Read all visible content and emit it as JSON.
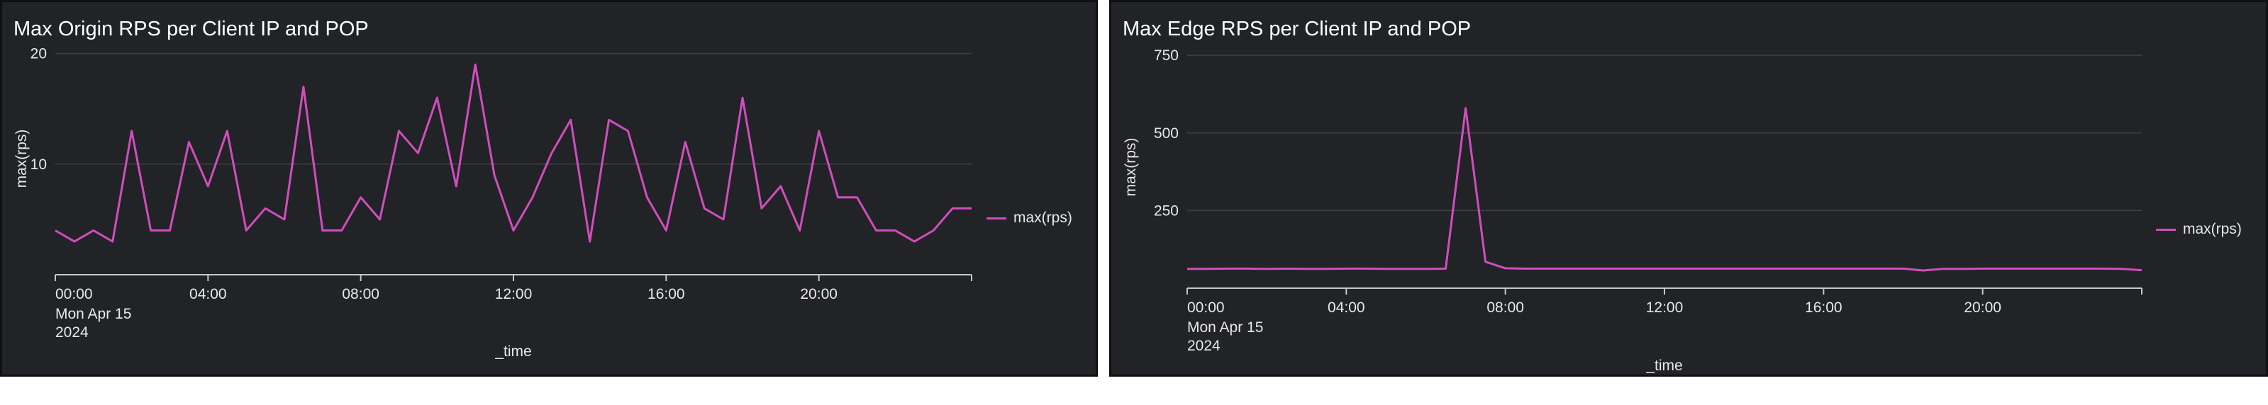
{
  "colors": {
    "panel_bg": "#212327",
    "series": "#d14dbd",
    "grid": "#3d4046",
    "axis": "#c8c8c8",
    "text": "#e8e8e8"
  },
  "panels": [
    {
      "title": "Max Origin RPS per Client IP and POP",
      "legend_label": "max(rps)"
    },
    {
      "title": "Max Edge RPS per Client IP and POP",
      "legend_label": "max(rps)"
    }
  ],
  "chart_data": [
    {
      "type": "line",
      "title": "Max Origin RPS per Client IP and POP",
      "xlabel": "_time",
      "ylabel": "max(rps)",
      "x_tick_labels": [
        "00:00",
        "04:00",
        "08:00",
        "12:00",
        "16:00",
        "20:00"
      ],
      "x_first_tick_sublabels": [
        "Mon Apr 15",
        "2024"
      ],
      "y_ticks": [
        10,
        20
      ],
      "ylim": [
        0,
        21
      ],
      "xlim_hours": [
        0,
        24
      ],
      "grid": true,
      "legend_position": "right",
      "series": [
        {
          "name": "max(rps)",
          "x_hours": [
            0,
            0.5,
            1,
            1.5,
            2,
            2.5,
            3,
            3.5,
            4,
            4.5,
            5,
            5.5,
            6,
            6.5,
            7,
            7.5,
            8,
            8.5,
            9,
            9.5,
            10,
            10.5,
            11,
            11.5,
            12,
            12.5,
            13,
            13.5,
            14,
            14.5,
            15,
            15.5,
            16,
            16.5,
            17,
            17.5,
            18,
            18.5,
            19,
            19.5,
            20,
            20.5,
            21,
            21.5,
            22,
            22.5,
            23,
            23.5,
            24
          ],
          "values": [
            4,
            3,
            4,
            3,
            13,
            4,
            4,
            12,
            8,
            13,
            4,
            6,
            5,
            17,
            4,
            4,
            7,
            5,
            13,
            11,
            16,
            8,
            19,
            9,
            4,
            7,
            11,
            14,
            3,
            14,
            13,
            7,
            4,
            12,
            6,
            5,
            16,
            6,
            8,
            4,
            13,
            7,
            7,
            4,
            4,
            3,
            4,
            6,
            6
          ]
        }
      ]
    },
    {
      "type": "line",
      "title": "Max Edge RPS per Client IP and POP",
      "xlabel": "_time",
      "ylabel": "max(rps)",
      "x_tick_labels": [
        "00:00",
        "04:00",
        "08:00",
        "12:00",
        "16:00",
        "20:00"
      ],
      "x_first_tick_sublabels": [
        "Mon Apr 15",
        "2024"
      ],
      "y_ticks": [
        250,
        500,
        750
      ],
      "ylim": [
        0,
        780
      ],
      "xlim_hours": [
        0,
        24
      ],
      "grid": true,
      "legend_position": "right",
      "series": [
        {
          "name": "max(rps)",
          "x_hours": [
            0,
            0.5,
            1,
            1.5,
            2,
            2.5,
            3,
            3.5,
            4,
            4.5,
            5,
            5.5,
            6,
            6.5,
            7,
            7.5,
            8,
            8.5,
            9,
            9.5,
            10,
            10.5,
            11,
            11.5,
            12,
            12.5,
            13,
            13.5,
            14,
            14.5,
            15,
            15.5,
            16,
            16.5,
            17,
            17.5,
            18,
            18.5,
            19,
            19.5,
            20,
            20.5,
            21,
            21.5,
            22,
            22.5,
            23,
            23.5,
            24
          ],
          "values": [
            62,
            62,
            63,
            63,
            62,
            63,
            62,
            62,
            63,
            63,
            62,
            62,
            62,
            63,
            580,
            85,
            64,
            63,
            63,
            63,
            63,
            63,
            63,
            63,
            63,
            63,
            63,
            63,
            63,
            63,
            63,
            63,
            63,
            63,
            63,
            63,
            63,
            57,
            62,
            62,
            63,
            63,
            63,
            63,
            63,
            63,
            63,
            62,
            58
          ]
        }
      ]
    }
  ]
}
